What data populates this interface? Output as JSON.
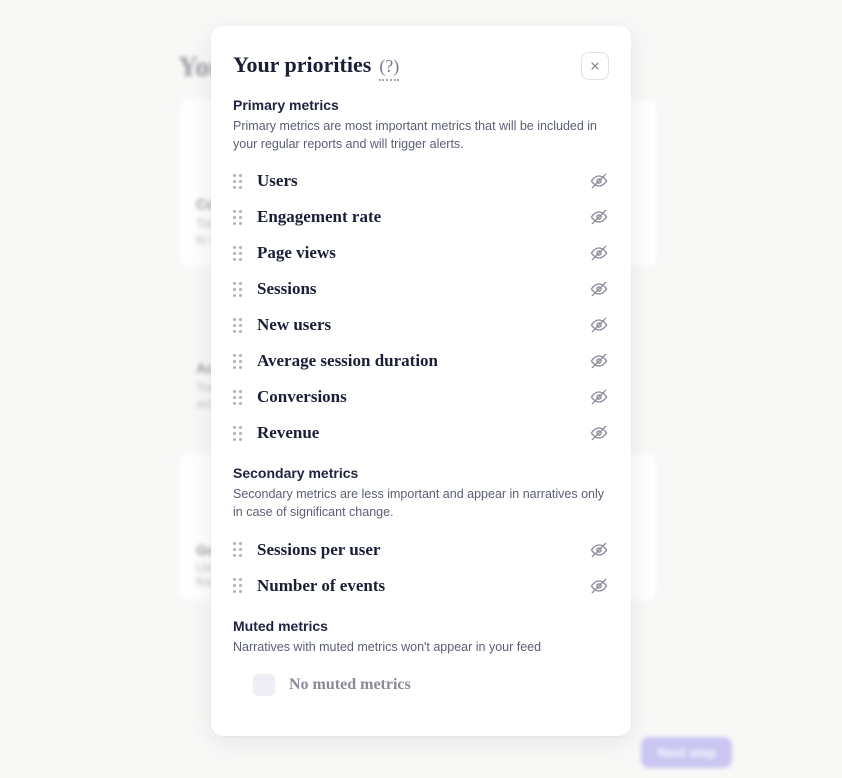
{
  "background": {
    "page_title": "You",
    "card1_label": "Con",
    "card1_sub1": "Tot",
    "card1_sub2": "to t",
    "card2_label1": "Act",
    "card2_label2": "Tra",
    "card2_sub": "act",
    "card3_label": "Go",
    "card3_sub1": "Und",
    "card3_sub2": "from",
    "next_label": "Next step"
  },
  "modal": {
    "title": "Your priorities",
    "help": "(?)",
    "sections": {
      "primary": {
        "title": "Primary metrics",
        "desc": "Primary metrics are most important metrics that will be included in your regular reports and will trigger alerts.",
        "items": [
          {
            "label": "Users"
          },
          {
            "label": "Engagement rate"
          },
          {
            "label": "Page views"
          },
          {
            "label": "Sessions"
          },
          {
            "label": "New users"
          },
          {
            "label": "Average session duration"
          },
          {
            "label": "Conversions"
          },
          {
            "label": "Revenue"
          }
        ]
      },
      "secondary": {
        "title": "Secondary metrics",
        "desc": "Secondary metrics are less important and appear in narratives only in case of significant change.",
        "items": [
          {
            "label": "Sessions per user"
          },
          {
            "label": "Number of events"
          }
        ]
      },
      "muted": {
        "title": "Muted metrics",
        "desc": "Narratives with muted metrics won't appear in your feed",
        "empty_label": "No muted metrics"
      }
    }
  }
}
